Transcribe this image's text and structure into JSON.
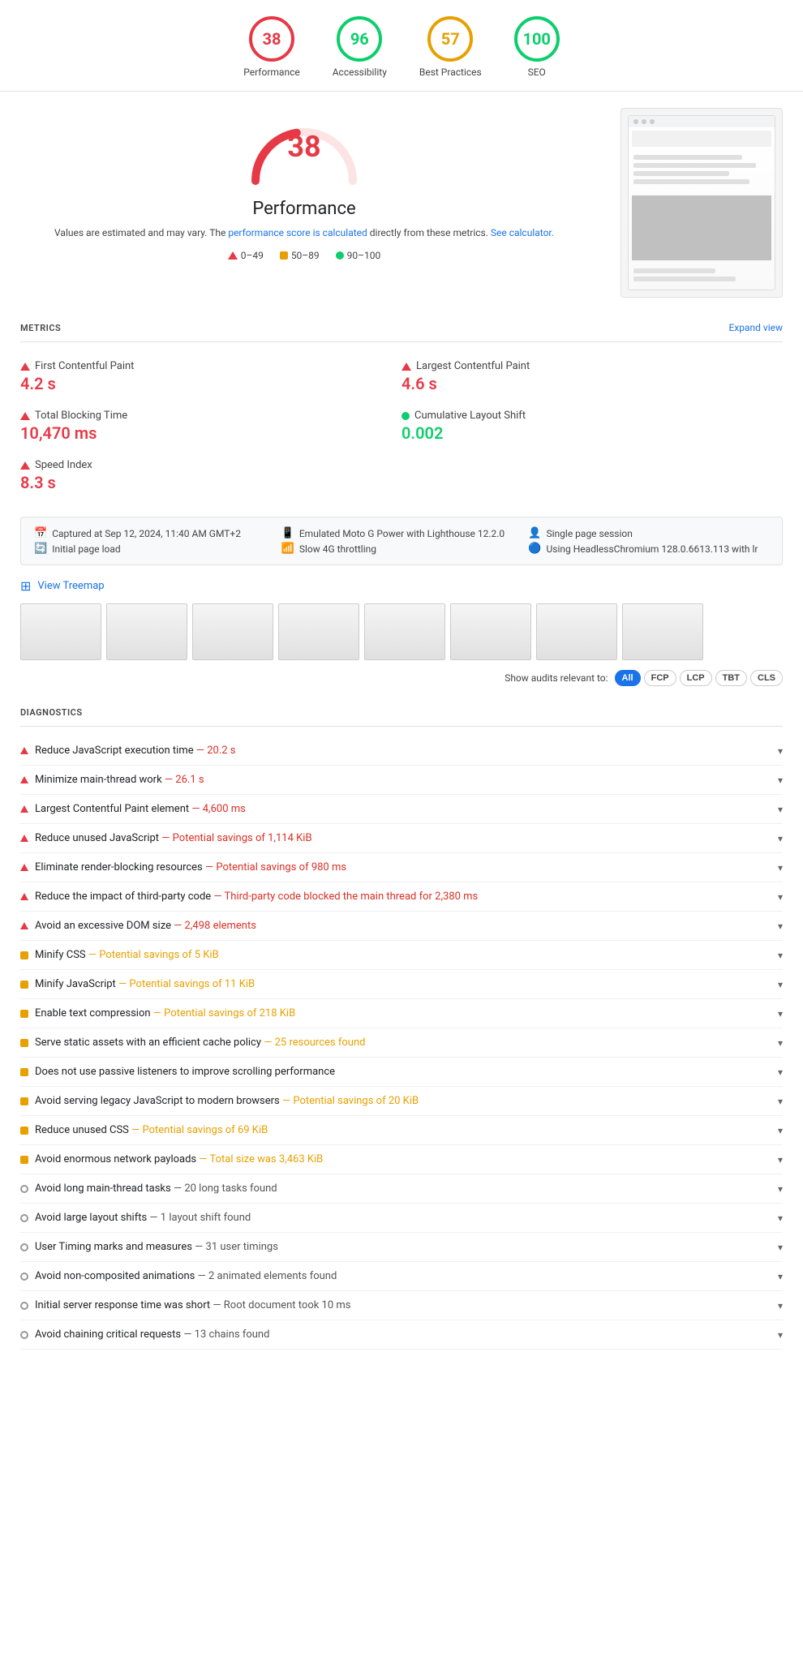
{
  "scores": [
    {
      "id": "performance",
      "value": 38,
      "label": "Performance",
      "color": "#e63946",
      "borderColor": "#e63946",
      "bg": "#fce4e4"
    },
    {
      "id": "accessibility",
      "value": 96,
      "label": "Accessibility",
      "color": "#0cce6b",
      "borderColor": "#0cce6b",
      "bg": "#e4fced"
    },
    {
      "id": "best-practices",
      "value": 57,
      "label": "Best Practices",
      "color": "#e8a000",
      "borderColor": "#e8a000",
      "bg": "#fdf5e4"
    },
    {
      "id": "seo",
      "value": 100,
      "label": "SEO",
      "color": "#0cce6b",
      "borderColor": "#0cce6b",
      "bg": "#e4fced"
    }
  ],
  "perf": {
    "score": 38,
    "title": "Performance",
    "desc": "Values are estimated and may vary. The",
    "link1_text": "performance score is calculated",
    "desc2": "directly from these metrics.",
    "link2_text": "See calculator.",
    "legend": [
      {
        "type": "triangle",
        "range": "0–49"
      },
      {
        "type": "square",
        "range": "50–89"
      },
      {
        "type": "circle",
        "range": "90–100"
      }
    ]
  },
  "metrics_title": "METRICS",
  "expand_label": "Expand view",
  "metrics": [
    {
      "id": "fcp",
      "icon": "triangle",
      "label": "First Contentful Paint",
      "value": "4.2 s",
      "color": "red"
    },
    {
      "id": "lcp",
      "icon": "triangle",
      "label": "Largest Contentful Paint",
      "value": "4.6 s",
      "color": "red"
    },
    {
      "id": "tbt",
      "icon": "triangle",
      "label": "Total Blocking Time",
      "value": "10,470 ms",
      "color": "red"
    },
    {
      "id": "cls",
      "icon": "dot",
      "label": "Cumulative Layout Shift",
      "value": "0.002",
      "color": "green"
    },
    {
      "id": "si",
      "icon": "triangle",
      "label": "Speed Index",
      "value": "8.3 s",
      "color": "red"
    }
  ],
  "info_bar": {
    "col1": [
      {
        "icon": "📅",
        "text": "Captured at Sep 12, 2024, 11:40 AM GMT+2"
      },
      {
        "icon": "🔄",
        "text": "Initial page load"
      }
    ],
    "col2": [
      {
        "icon": "📱",
        "text": "Emulated Moto G Power with Lighthouse 12.2.0"
      },
      {
        "icon": "📶",
        "text": "Slow 4G throttling"
      }
    ],
    "col3": [
      {
        "icon": "👤",
        "text": "Single page session"
      },
      {
        "icon": "🔵",
        "text": "Using HeadlessChromium 128.0.6613.113 with lr"
      }
    ]
  },
  "treemap_label": "View Treemap",
  "filter_bar": {
    "label": "Show audits relevant to:",
    "buttons": [
      {
        "label": "All",
        "active": true
      },
      {
        "label": "FCP",
        "active": false
      },
      {
        "label": "LCP",
        "active": false
      },
      {
        "label": "TBT",
        "active": false
      },
      {
        "label": "CLS",
        "active": false
      }
    ]
  },
  "diagnostics_title": "DIAGNOSTICS",
  "diagnostics": [
    {
      "icon": "triangle",
      "text": "Reduce JavaScript execution time",
      "detail": "— 20.2 s",
      "detail_color": "red"
    },
    {
      "icon": "triangle",
      "text": "Minimize main-thread work",
      "detail": "— 26.1 s",
      "detail_color": "red"
    },
    {
      "icon": "triangle",
      "text": "Largest Contentful Paint element",
      "detail": "— 4,600 ms",
      "detail_color": "red"
    },
    {
      "icon": "triangle",
      "text": "Reduce unused JavaScript",
      "detail": "— Potential savings of 1,114 KiB",
      "detail_color": "red"
    },
    {
      "icon": "triangle",
      "text": "Eliminate render-blocking resources",
      "detail": "— Potential savings of 980 ms",
      "detail_color": "red"
    },
    {
      "icon": "triangle",
      "text": "Reduce the impact of third-party code",
      "detail": "— Third-party code blocked the main thread for 2,380 ms",
      "detail_color": "red"
    },
    {
      "icon": "triangle",
      "text": "Avoid an excessive DOM size",
      "detail": "— 2,498 elements",
      "detail_color": "red"
    },
    {
      "icon": "square",
      "text": "Minify CSS",
      "detail": "— Potential savings of 5 KiB",
      "detail_color": "orange"
    },
    {
      "icon": "square",
      "text": "Minify JavaScript",
      "detail": "— Potential savings of 11 KiB",
      "detail_color": "orange"
    },
    {
      "icon": "square",
      "text": "Enable text compression",
      "detail": "— Potential savings of 218 KiB",
      "detail_color": "orange"
    },
    {
      "icon": "square",
      "text": "Serve static assets with an efficient cache policy",
      "detail": "— 25 resources found",
      "detail_color": "orange"
    },
    {
      "icon": "square",
      "text": "Does not use passive listeners to improve scrolling performance",
      "detail": "",
      "detail_color": "orange"
    },
    {
      "icon": "square",
      "text": "Avoid serving legacy JavaScript to modern browsers",
      "detail": "— Potential savings of 20 KiB",
      "detail_color": "orange"
    },
    {
      "icon": "square",
      "text": "Reduce unused CSS",
      "detail": "— Potential savings of 69 KiB",
      "detail_color": "orange"
    },
    {
      "icon": "square",
      "text": "Avoid enormous network payloads",
      "detail": "— Total size was 3,463 KiB",
      "detail_color": "orange"
    },
    {
      "icon": "circle",
      "text": "Avoid long main-thread tasks",
      "detail": "— 20 long tasks found",
      "detail_color": "gray"
    },
    {
      "icon": "circle",
      "text": "Avoid large layout shifts",
      "detail": "— 1 layout shift found",
      "detail_color": "gray"
    },
    {
      "icon": "circle",
      "text": "User Timing marks and measures",
      "detail": "— 31 user timings",
      "detail_color": "gray"
    },
    {
      "icon": "circle",
      "text": "Avoid non-composited animations",
      "detail": "— 2 animated elements found",
      "detail_color": "gray"
    },
    {
      "icon": "circle",
      "text": "Initial server response time was short",
      "detail": "— Root document took 10 ms",
      "detail_color": "gray"
    },
    {
      "icon": "circle",
      "text": "Avoid chaining critical requests",
      "detail": "— 13 chains found",
      "detail_color": "gray"
    }
  ]
}
